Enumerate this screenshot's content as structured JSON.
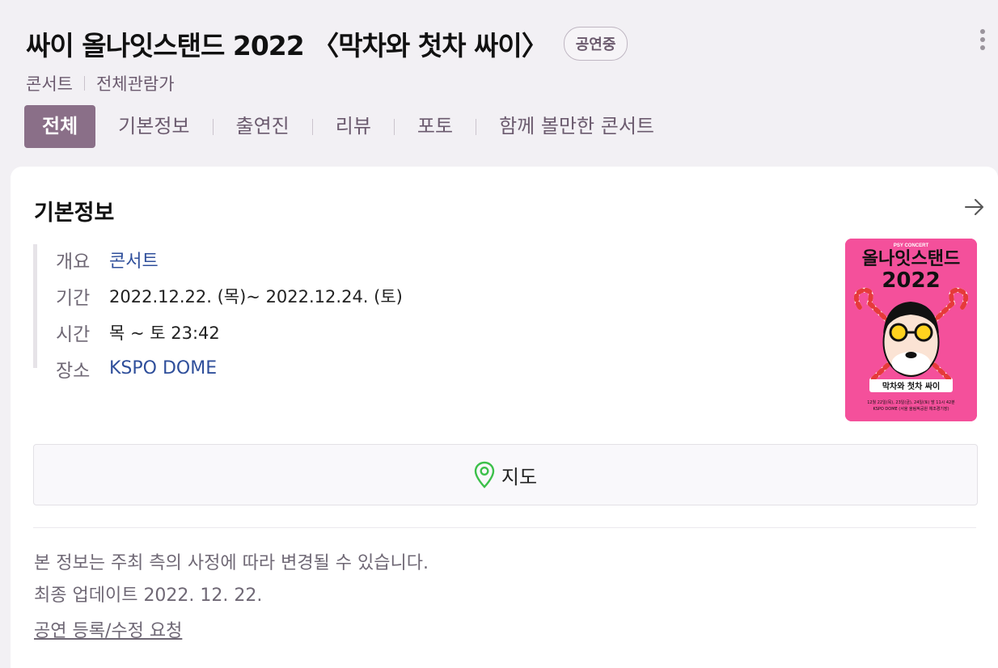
{
  "header": {
    "title": "싸이 올나잇스탠드 2022 〈막차와 첫차 싸이〉",
    "status_badge": "공연중",
    "category": "콘서트",
    "age_rating": "전체관람가"
  },
  "tabs": [
    {
      "label": "전체",
      "active": true
    },
    {
      "label": "기본정보"
    },
    {
      "label": "출연진"
    },
    {
      "label": "리뷰"
    },
    {
      "label": "포토"
    },
    {
      "label": "함께 볼만한 콘서트"
    }
  ],
  "basic_info": {
    "title": "기본정보",
    "rows": [
      {
        "label": "개요",
        "value": "콘서트"
      },
      {
        "label": "기간",
        "value": "2022.12.22. (목)~ 2022.12.24. (토)"
      },
      {
        "label": "시간",
        "value": "목 ~ 토 23:42"
      },
      {
        "label": "장소",
        "value": "KSPO DOME"
      }
    ],
    "poster": {
      "top_text": "PSY CONCERT",
      "main_text": "올나잇스탠드",
      "year_text": "2022",
      "bottom_text": "막차와 첫차 싸이",
      "date_line": "12월 22일(목), 23일(금), 24일(토) 밤 11시 42분",
      "venue_line": "KSPO DOME (서울 올림픽공원 체조경기장)",
      "bg_color": "#f4509b"
    }
  },
  "map": {
    "label": "지도",
    "icon": "map-pin-icon",
    "icon_color": "#3cc04a"
  },
  "footer": {
    "notice": "본 정보는 주최 측의 사정에 따라 변경될 수 있습니다.",
    "updated_label": "최종 업데이트",
    "updated_date": "2022. 12. 22.",
    "request_link": "공연 등록/수정 요청"
  },
  "colors": {
    "accent": "#8a6f88",
    "link": "#2f4f9b",
    "muted": "#6b5a6e"
  }
}
